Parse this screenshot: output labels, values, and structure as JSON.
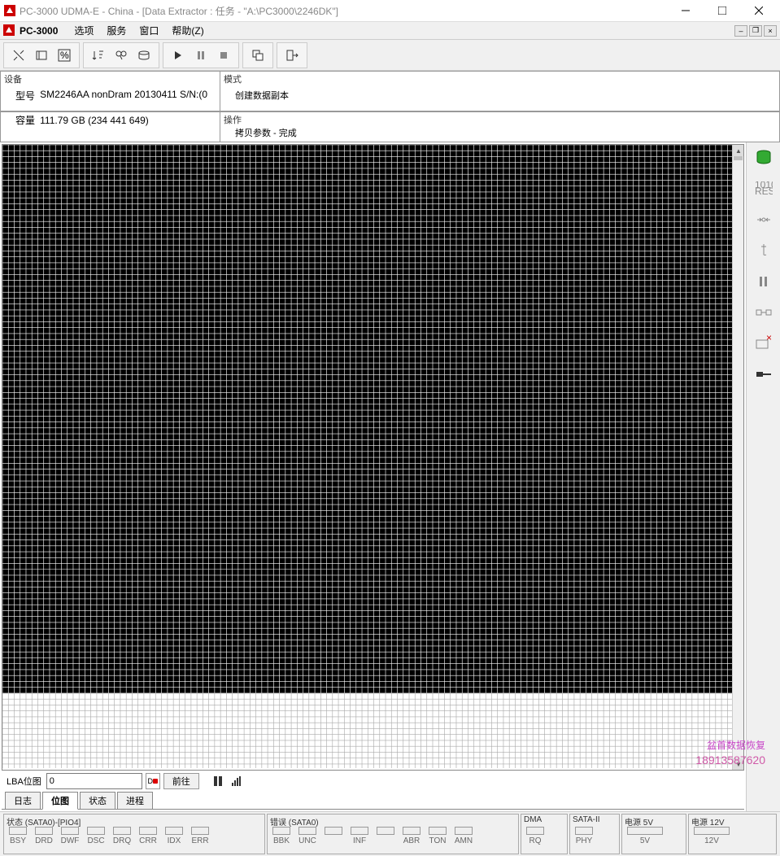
{
  "window": {
    "title": "PC-3000 UDMA-E - China - [Data Extractor : 任务 - \"A:\\PC3000\\2246DK\"]"
  },
  "menu": {
    "app": "PC-3000",
    "items": [
      "选项",
      "服务",
      "窗口",
      "帮助(Z)"
    ]
  },
  "info": {
    "device_label": "设备",
    "model_label": "型号",
    "model_value": "SM2246AA nonDram 20130411 S/N:(0",
    "capacity_label": "容量",
    "capacity_value": "111.79 GB (234 441 649)",
    "mode_label": "模式",
    "mode_value": "创建数据副本",
    "op_label": "操作",
    "op_value": "拷贝参数 - 完成"
  },
  "lba": {
    "label": "LBA位图",
    "value": "0",
    "goto": "前往"
  },
  "tabs": [
    "日志",
    "位图",
    "状态",
    "进程"
  ],
  "active_tab": 1,
  "status": {
    "state_title": "状态 (SATA0)-[PIO4]",
    "state_leds": [
      "BSY",
      "DRD",
      "DWF",
      "DSC",
      "DRQ",
      "CRR",
      "IDX",
      "ERR"
    ],
    "error_title": "错误 (SATA0)",
    "error_leds": [
      "BBK",
      "UNC",
      "",
      "INF",
      "",
      "ABR",
      "TON",
      "AMN"
    ],
    "dma_title": "DMA",
    "dma_led": "RQ",
    "sata_title": "SATA-II",
    "sata_led": "PHY",
    "p5_title": "电源 5V",
    "p5_led": "5V",
    "p12_title": "电源 12V",
    "p12_led": "12V"
  },
  "watermark": {
    "line1": "盆首数据恢复",
    "line2": "18913587620"
  },
  "map": {
    "fill_ratio": 0.89,
    "cell": 7
  }
}
